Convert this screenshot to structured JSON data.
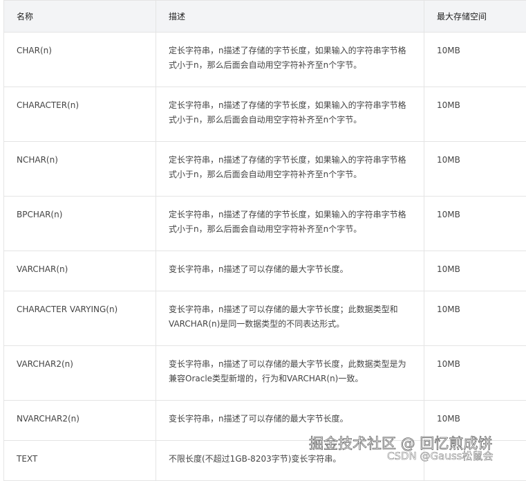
{
  "headers": [
    "名称",
    "描述",
    "最大存储空间"
  ],
  "rows": [
    {
      "name": "CHAR(n)",
      "desc": "定长字符串，n描述了存储的字节长度，如果输入的字符串字节格式小于n，那么后面会自动用空字符补齐至n个字节。",
      "size": "10MB"
    },
    {
      "name": "CHARACTER(n)",
      "desc": "定长字符串，n描述了存储的字节长度，如果输入的字符串字节格式小于n，那么后面会自动用空字符补齐至n个字节。",
      "size": "10MB"
    },
    {
      "name": "NCHAR(n)",
      "desc": "定长字符串，n描述了存储的字节长度，如果输入的字符串字节格式小于n，那么后面会自动用空字符补齐至n个字节。",
      "size": "10MB"
    },
    {
      "name": "BPCHAR(n)",
      "desc": "定长字符串，n描述了存储的字节长度，如果输入的字符串字节格式小于n，那么后面会自动用空字符补齐至n个字节。",
      "size": "10MB"
    },
    {
      "name": "VARCHAR(n)",
      "desc": "变长字符串，n描述了可以存储的最大字节长度。",
      "size": "10MB"
    },
    {
      "name": "CHARACTER VARYING(n)",
      "desc": "变长字符串，n描述了可以存储的最大字节长度；此数据类型和VARCHAR(n)是同一数据类型的不同表达形式。",
      "size": "10MB"
    },
    {
      "name": "VARCHAR2(n)",
      "desc": "变长字符串，n描述了可以存储的最大字节长度，此数据类型是为兼容Oracle类型新增的，行为和VARCHAR(n)一致。",
      "size": "10MB"
    },
    {
      "name": "NVARCHAR2(n)",
      "desc": "变长字符串，n描述了可以存储的最大字节长度。",
      "size": "10MB"
    },
    {
      "name": "TEXT",
      "desc": "不限长度(不超过1GB-8203字节)变长字符串。",
      "size": ""
    }
  ],
  "watermarks": [
    "掘金技术社区 @ 回忆煎成饼",
    "CSDN @Gauss松鼠会"
  ]
}
